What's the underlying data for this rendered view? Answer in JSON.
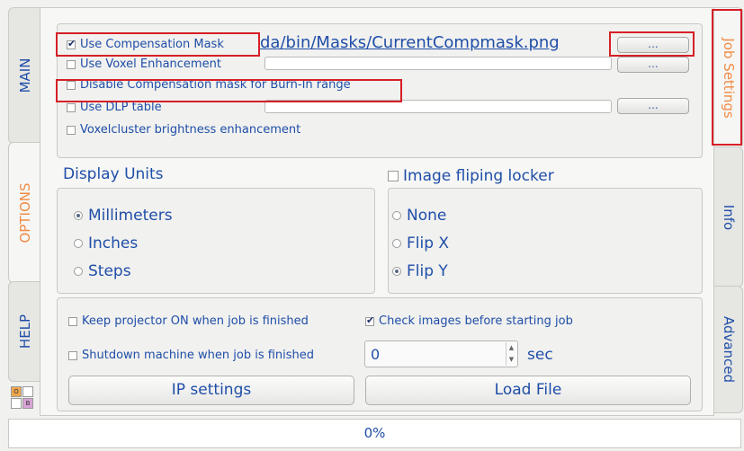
{
  "tabs_left": [
    "MAIN",
    "OPTIONS",
    "HELP"
  ],
  "tabs_right": [
    "Job Settings",
    "Info",
    "Advanced"
  ],
  "mask_group": {
    "use_comp_mask": "Use Compensation Mask",
    "comp_mask_path": "da/bin/Masks/CurrentCompmask.png",
    "browse_label": "...",
    "use_voxel": "Use Voxel Enhancement",
    "disable_comp": "Disable Compensation mask for Burn-In range",
    "use_dlp": "Use DLP table",
    "voxelcluster": "Voxelcluster brightness enhancement"
  },
  "display_units": {
    "title": "Display Units",
    "options": [
      "Millimeters",
      "Inches",
      "Steps"
    ],
    "selected": "Millimeters"
  },
  "image_flip": {
    "title": "Image fliping locker",
    "options": [
      "None",
      "Flip X",
      "Flip Y"
    ],
    "selected": "Flip Y"
  },
  "job_group": {
    "keep_projector": "Keep projector ON when job is finished",
    "check_images": "Check images before starting job",
    "shutdown": "Shutdown machine when job is finished",
    "shutdown_value": "0",
    "shutdown_unit": "sec",
    "ip_settings": "IP settings",
    "load_file": "Load File"
  },
  "badges": [
    "O",
    "B"
  ],
  "progress": {
    "text": "0%",
    "value": 0
  },
  "colors": {
    "accent": "#1f4ea8",
    "active_tab": "#f08a45",
    "highlight": "#d61f26"
  }
}
